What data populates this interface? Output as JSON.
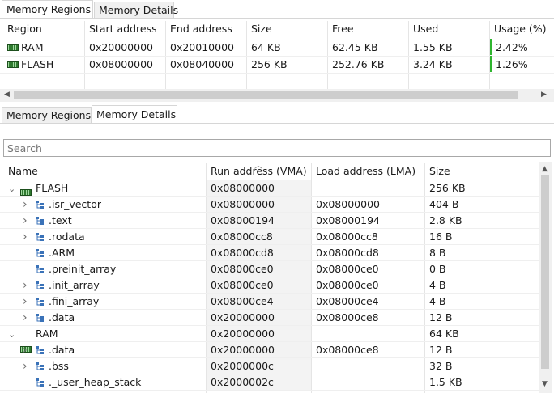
{
  "top_tabs": [
    "Memory Regions",
    "Memory Details"
  ],
  "regions_table": {
    "columns": [
      "Region",
      "Start address",
      "End address",
      "Size",
      "Free",
      "Used",
      "Usage (%)"
    ],
    "rows": [
      {
        "name": "RAM",
        "start": "0x20000000",
        "end": "0x20010000",
        "size": "64 KB",
        "free": "62.45 KB",
        "used": "1.55 KB",
        "usage": "2.42%",
        "usage_value": 2.42
      },
      {
        "name": "FLASH",
        "start": "0x08000000",
        "end": "0x08040000",
        "size": "256 KB",
        "free": "252.76 KB",
        "used": "3.24 KB",
        "usage": "1.26%",
        "usage_value": 1.26
      }
    ]
  },
  "bottom_tabs": [
    "Memory Regions",
    "Memory Details"
  ],
  "search": {
    "placeholder": "Search"
  },
  "details_table": {
    "columns": [
      "Name",
      "Run address (VMA)",
      "Load address (LMA)",
      "Size"
    ],
    "rows": [
      {
        "name": "FLASH",
        "vma": "0x08000000",
        "lma": "",
        "size": "256 KB",
        "level": 0,
        "expanded": true
      },
      {
        "name": ".isr_vector",
        "vma": "0x08000000",
        "lma": "0x08000000",
        "size": "404 B",
        "level": 1,
        "expandable": true
      },
      {
        "name": ".text",
        "vma": "0x08000194",
        "lma": "0x08000194",
        "size": "2.8 KB",
        "level": 1,
        "expandable": true
      },
      {
        "name": ".rodata",
        "vma": "0x08000cc8",
        "lma": "0x08000cc8",
        "size": "16 B",
        "level": 1,
        "expandable": true
      },
      {
        "name": ".ARM",
        "vma": "0x08000cd8",
        "lma": "0x08000cd8",
        "size": "8 B",
        "level": 1,
        "expandable": false
      },
      {
        "name": ".preinit_array",
        "vma": "0x08000ce0",
        "lma": "0x08000ce0",
        "size": "0 B",
        "level": 1,
        "expandable": false
      },
      {
        "name": ".init_array",
        "vma": "0x08000ce0",
        "lma": "0x08000ce0",
        "size": "4 B",
        "level": 1,
        "expandable": true
      },
      {
        "name": ".fini_array",
        "vma": "0x08000ce4",
        "lma": "0x08000ce4",
        "size": "4 B",
        "level": 1,
        "expandable": true
      },
      {
        "name": ".data",
        "vma": "0x20000000",
        "lma": "0x08000ce8",
        "size": "12 B",
        "level": 1,
        "expandable": true
      },
      {
        "name": "RAM",
        "vma": "0x20000000",
        "lma": "",
        "size": "64 KB",
        "level": 0,
        "expanded": true
      },
      {
        "name": ".data",
        "vma": "0x20000000",
        "lma": "0x08000ce8",
        "size": "12 B",
        "level": 1,
        "expandable": true
      },
      {
        "name": ".bss",
        "vma": "0x2000000c",
        "lma": "",
        "size": "32 B",
        "level": 1,
        "expandable": true
      },
      {
        "name": "._user_heap_stack",
        "vma": "0x2000002c",
        "lma": "",
        "size": "1.5 KB",
        "level": 1,
        "expandable": false
      }
    ]
  },
  "colors": {
    "usage_bar": "#2fb52f",
    "memory_icon": "#2f7a2f",
    "section_icon": "#3a72b8"
  }
}
